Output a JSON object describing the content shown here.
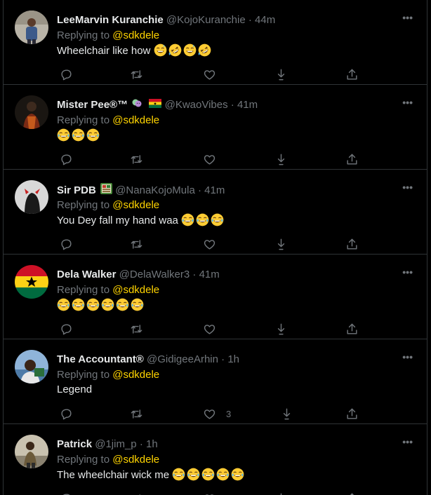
{
  "replying_prefix": "Replying to",
  "tweets": [
    {
      "name": "LeeMarvin Kuranchie",
      "handle": "@KojoKuranchie",
      "time": "44m",
      "reply_to": "@sdkdele",
      "text": "Wheelchair like how",
      "emojis": [
        "grinning-sweat",
        "rofl",
        "grinning-sweat",
        "rofl"
      ]
    },
    {
      "name": "Mister Pee®™",
      "badges": [
        "theater-masks-icon",
        "ghana-flag-icon"
      ],
      "handle": "@KwaoVibes",
      "time": "41m",
      "reply_to": "@sdkdele",
      "text": "",
      "emojis": [
        "joy",
        "joy",
        "joy"
      ]
    },
    {
      "name": "Sir PDB",
      "badges": [
        "app-badge-icon"
      ],
      "handle": "@NanaKojoMula",
      "time": "41m",
      "reply_to": "@sdkdele",
      "text": "You Dey fall my hand waa",
      "emojis": [
        "joy",
        "joy",
        "joy"
      ]
    },
    {
      "name": "Dela Walker",
      "handle": "@DelaWalker3",
      "time": "41m",
      "reply_to": "@sdkdele",
      "text": "",
      "emojis": [
        "joy",
        "joy",
        "joy",
        "joy",
        "joy",
        "joy"
      ]
    },
    {
      "name": "The Accountant®",
      "handle": "@GidigeeArhin",
      "time": "1h",
      "reply_to": "@sdkdele",
      "text": "Legend",
      "like_count": "3",
      "emojis": []
    },
    {
      "name": "Patrick",
      "handle": "@1jim_p",
      "time": "1h",
      "reply_to": "@sdkdele",
      "text": "The wheelchair wick me",
      "emojis": [
        "joy",
        "joy",
        "joy",
        "joy",
        "joy"
      ]
    }
  ],
  "colors": {
    "background": "#000000",
    "text": "#e7e9ea",
    "muted": "#71767b",
    "mention": "#ffd400",
    "divider": "#2f3336"
  }
}
